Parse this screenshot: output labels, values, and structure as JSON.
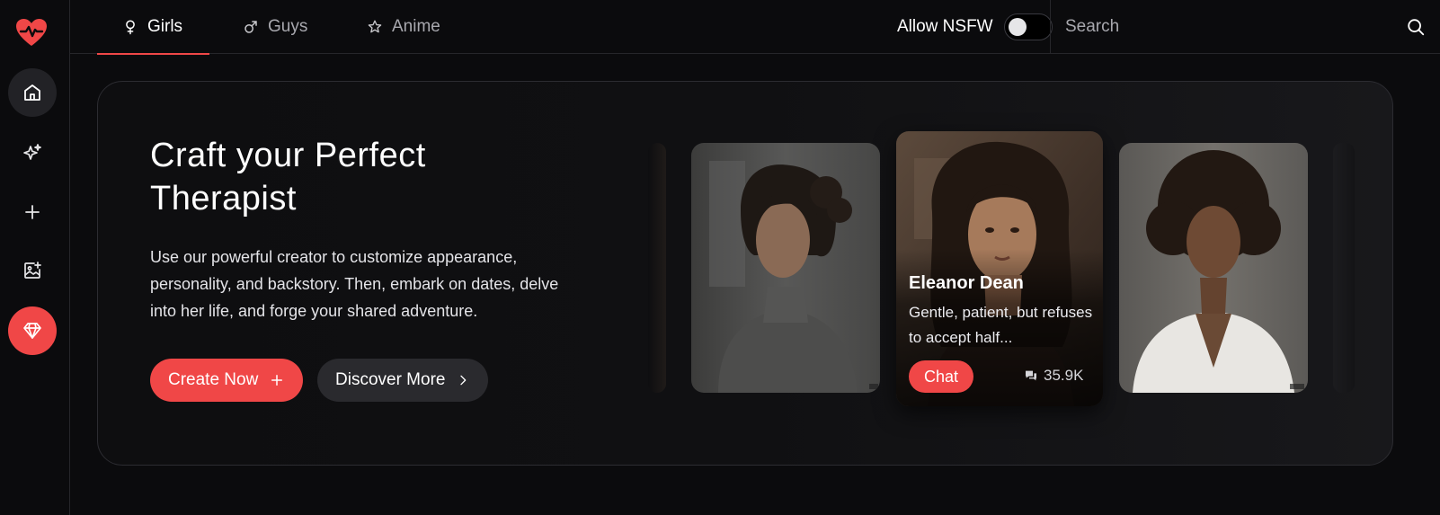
{
  "tabs": [
    {
      "label": "Girls",
      "icon": "female-icon"
    },
    {
      "label": "Guys",
      "icon": "male-icon"
    },
    {
      "label": "Anime",
      "icon": "star-icon"
    }
  ],
  "nsfw": {
    "label": "Allow NSFW",
    "enabled": false
  },
  "search": {
    "placeholder": "Search"
  },
  "sidebar": {
    "items": [
      {
        "name": "home",
        "icon": "home-icon",
        "active": true
      },
      {
        "name": "discover",
        "icon": "sparkles-icon"
      },
      {
        "name": "create",
        "icon": "plus-icon"
      },
      {
        "name": "generate-image",
        "icon": "image-plus-icon"
      },
      {
        "name": "premium",
        "icon": "diamond-icon"
      }
    ]
  },
  "hero": {
    "title": "Craft your Perfect Therapist",
    "description": "Use our powerful creator to customize appearance, personality, and backstory. Then, embark on dates, delve into her life, and forge your shared adventure.",
    "create_label": "Create Now",
    "discover_label": "Discover More"
  },
  "featured": {
    "name": "Eleanor Dean",
    "description": "Gentle, patient, but refuses to accept half...",
    "chat_label": "Chat",
    "chat_count": "35.9K"
  },
  "colors": {
    "accent": "#f04747",
    "background": "#0b0b0d",
    "surface": "#2a2a2e"
  }
}
